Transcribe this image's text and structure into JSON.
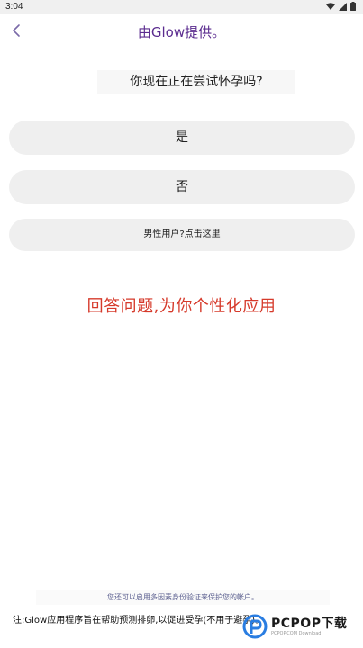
{
  "status_bar": {
    "time": "3:04",
    "icons": [
      "wifi-icon",
      "signal-icon",
      "battery-icon"
    ]
  },
  "header": {
    "title": "由Glow提供。",
    "back_icon": "chevron-left-icon"
  },
  "question": "你现在正在尝试怀孕吗?",
  "options": {
    "yes": "是",
    "no": "否",
    "male": "男性用户?点击这里"
  },
  "promo_text": "回答问题,为你个性化应用",
  "mfa_link": "您还可以启用多因素身份验证来保护您的帐户。",
  "disclaimer": "注:Glow应用程序旨在帮助预测排卵,以促进受孕(不用于避孕)。",
  "watermark": {
    "logo_icon": "pcpop-logo-icon",
    "text": "PCPOP下载",
    "sub": "PCPOP.COM Download"
  },
  "colors": {
    "title_purple": "#5b2c8f",
    "promo_red": "#d63a2b",
    "button_bg": "#efefef",
    "link_blue": "#5b5f8f"
  }
}
